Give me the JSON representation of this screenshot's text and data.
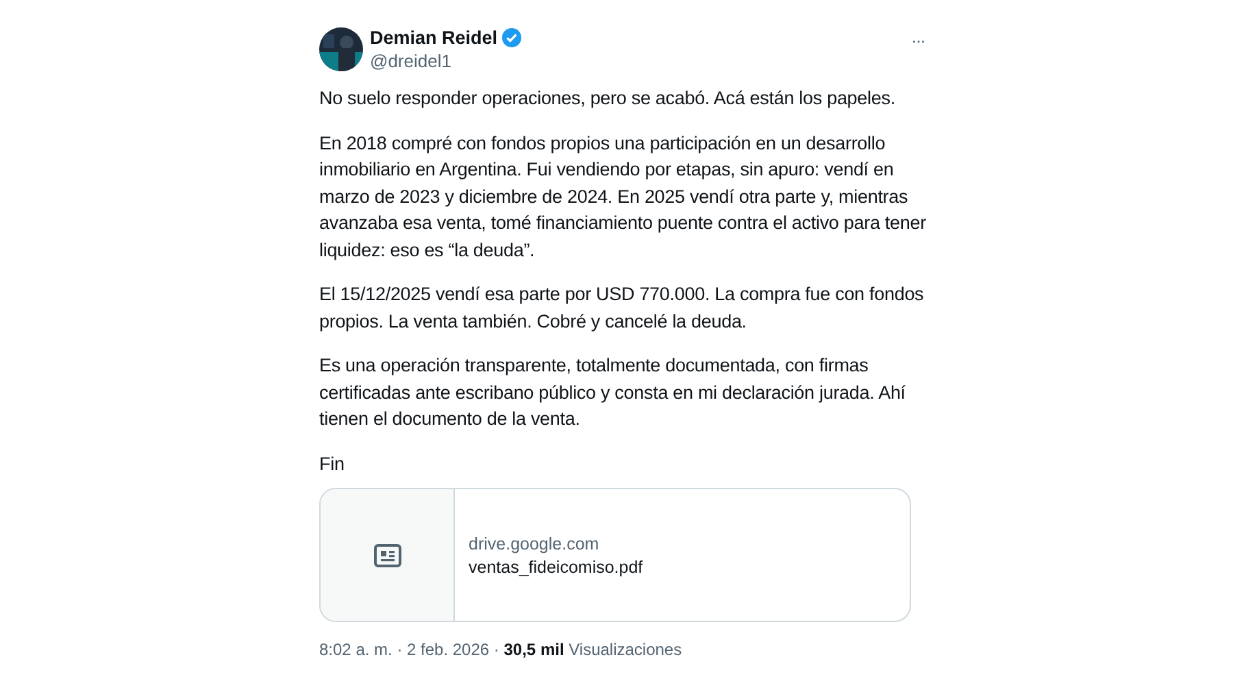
{
  "author": {
    "name": "Demian Reidel",
    "handle": "@dreidel1",
    "verified": true
  },
  "more_button": "···",
  "paragraphs": [
    "No suelo responder operaciones, pero se acabó. Acá están los papeles.",
    "En 2018 compré con fondos propios una participación en un desarrollo inmobiliario en Argentina. Fui vendiendo por etapas, sin apuro: vendí en marzo de 2023 y diciembre de 2024. En 2025 vendí otra parte y, mientras avanzaba esa venta, tomé financiamiento puente contra el activo para tener liquidez: eso es “la deuda”.",
    "El 15/12/2025 vendí esa parte por USD 770.000. La compra fue con fondos propios. La venta también. Cobré y cancelé la deuda.",
    "Es una operación transparente, totalmente documentada, con firmas certificadas ante escribano público y consta en mi declaración jurada. Ahí tienen el documento de la venta.",
    "Fin"
  ],
  "link_card": {
    "domain": "drive.google.com",
    "title": "ventas_fideicomiso.pdf"
  },
  "footer": "8:02 a. m. · 2 feb. 2026 · **30,5 mil** Visualizaciones"
}
